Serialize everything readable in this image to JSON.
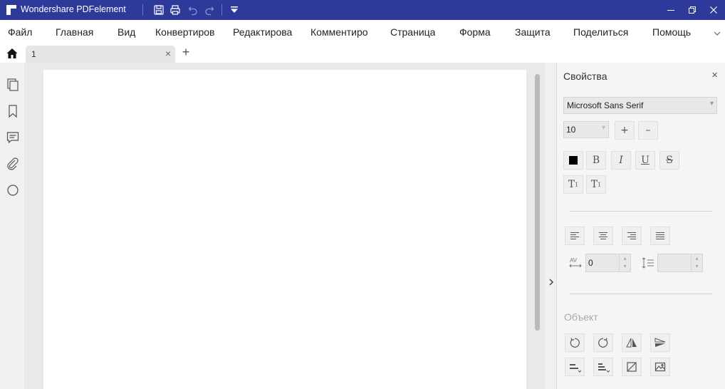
{
  "window": {
    "app_title": "Wondershare PDFelement"
  },
  "menu": {
    "items": [
      "Файл",
      "Главная",
      "Вид",
      "Конвертиров",
      "Редактирова",
      "Комментиро",
      "Страница",
      "Форма",
      "Защита",
      "Поделиться",
      "Помощь"
    ]
  },
  "tabs": {
    "items": [
      {
        "label": "1"
      }
    ],
    "close_glyph": "×",
    "add_glyph": "+"
  },
  "left_sidebar": {
    "icons": [
      "pages-icon",
      "bookmark-icon",
      "comment-icon",
      "attachment-icon",
      "search-icon"
    ]
  },
  "properties": {
    "title": "Свойства",
    "close_glyph": "×",
    "font_family": "Microsoft Sans Serif",
    "font_size": "10",
    "char_spacing": "0",
    "line_spacing": "",
    "object_section": "Объект",
    "text_style_buttons": [
      "color-swatch",
      "bold",
      "italic",
      "underline",
      "strikethrough",
      "superscript",
      "subscript"
    ],
    "align_buttons": [
      "align-left",
      "align-center",
      "align-right",
      "justify"
    ],
    "object_buttons": [
      "rotate-left",
      "rotate-right",
      "flip-horizontal",
      "flip-vertical",
      "align-objects",
      "distribute-objects",
      "crop",
      "replace-image"
    ]
  },
  "colors": {
    "titlebar": "#2d3a99",
    "text_color_swatch": "#000000"
  }
}
